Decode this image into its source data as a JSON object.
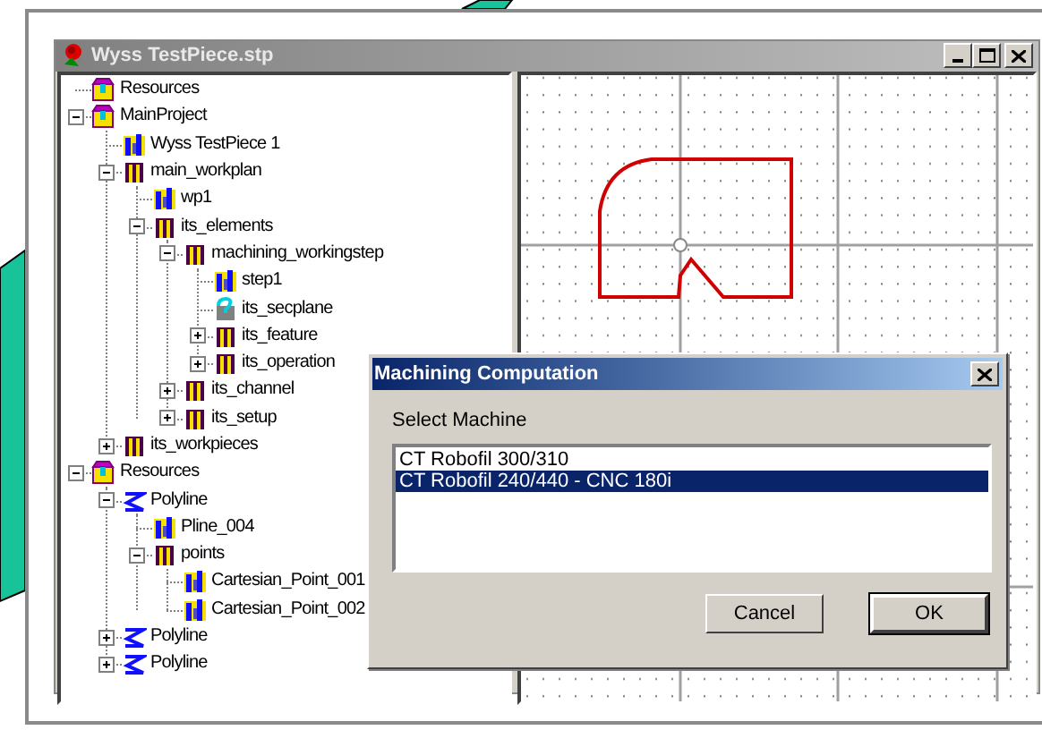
{
  "window": {
    "title": "Wyss TestPiece.stp"
  },
  "tree": [
    {
      "label": "Resources",
      "kind": "folder"
    },
    {
      "label": "MainProject",
      "kind": "folder",
      "expanded": true,
      "children": [
        {
          "label": "Wyss TestPiece 1",
          "kind": "id"
        },
        {
          "label": "main_workplan",
          "kind": "entity",
          "expanded": true,
          "children": [
            {
              "label": "wp1",
              "kind": "id"
            },
            {
              "label": "its_elements",
              "kind": "entity",
              "expanded": true,
              "children": [
                {
                  "label": "machining_workingstep",
                  "kind": "entity",
                  "expanded": true,
                  "children": [
                    {
                      "label": "step1",
                      "kind": "id"
                    },
                    {
                      "label": "its_secplane",
                      "kind": "query"
                    },
                    {
                      "label": "its_feature",
                      "kind": "entity",
                      "expanded": false
                    },
                    {
                      "label": "its_operation",
                      "kind": "entity",
                      "expanded": false
                    }
                  ]
                },
                {
                  "label": "its_channel",
                  "kind": "entity",
                  "expanded": false
                },
                {
                  "label": "its_setup",
                  "kind": "entity",
                  "expanded": false
                }
              ]
            }
          ]
        },
        {
          "label": "its_workpieces",
          "kind": "entity",
          "expanded": false
        }
      ]
    },
    {
      "label": "Resources",
      "kind": "folder",
      "expanded": true,
      "children": [
        {
          "label": "Polyline",
          "kind": "polyline",
          "expanded": true,
          "children": [
            {
              "label": "Pline_004",
              "kind": "id"
            },
            {
              "label": "points",
              "kind": "entity",
              "expanded": true,
              "children": [
                {
                  "label": "Cartesian_Point_001",
                  "kind": "id"
                },
                {
                  "label": "Cartesian_Point_002",
                  "kind": "id"
                }
              ]
            }
          ]
        },
        {
          "label": "Polyline",
          "kind": "polyline",
          "expanded": false
        },
        {
          "label": "Polyline",
          "kind": "polyline",
          "expanded": false
        }
      ]
    }
  ],
  "dialog": {
    "title": "Machining Computation",
    "label": "Select Machine",
    "machines": [
      {
        "label": "CT Robofil 300/310",
        "selected": false
      },
      {
        "label": "CT Robofil 240/440 - CNC 180i",
        "selected": true
      }
    ],
    "buttons": [
      {
        "label": "Cancel",
        "default": false
      },
      {
        "label": "OK",
        "default": true
      }
    ]
  }
}
